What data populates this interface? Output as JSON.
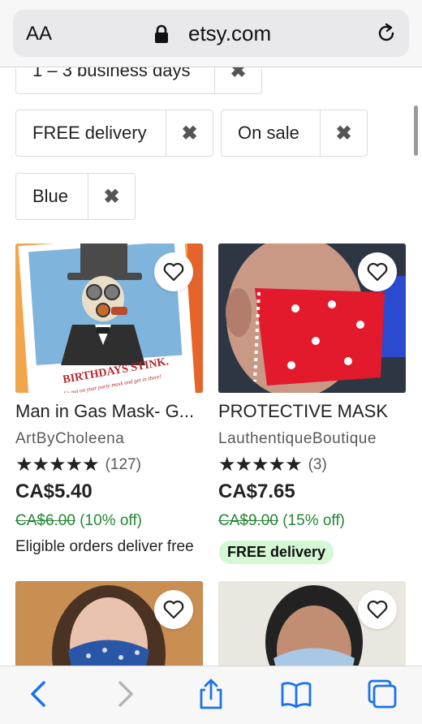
{
  "browser": {
    "aa_label": "AA",
    "domain": "etsy.com"
  },
  "filters": [
    {
      "label": "1 – 3 business days"
    },
    {
      "label": "FREE delivery"
    },
    {
      "label": "On sale"
    },
    {
      "label": "Blue"
    }
  ],
  "listings": [
    {
      "title": "Man in Gas Mask- G...",
      "shop": "ArtByCholeena",
      "stars": "★★★★★",
      "review_count": "(127)",
      "price": "CA$5.40",
      "original_price": "CA$6.00",
      "discount": "(10% off)",
      "note": "Eligible orders deliver free",
      "card_text_1": "BIRTHDAYS STINK.",
      "card_text_2": "So put on your party mask and get in there!"
    },
    {
      "title": "PROTECTIVE MASK",
      "shop": "LauthentiqueBoutique",
      "stars": "★★★★★",
      "review_count": "(3)",
      "price": "CA$7.65",
      "original_price": "CA$9.00",
      "discount": "(15% off)",
      "badge": "FREE delivery"
    }
  ],
  "colors": {
    "sale_green": "#258635",
    "badge_bg": "#d4f7d4",
    "ios_blue": "#1a73e8"
  }
}
